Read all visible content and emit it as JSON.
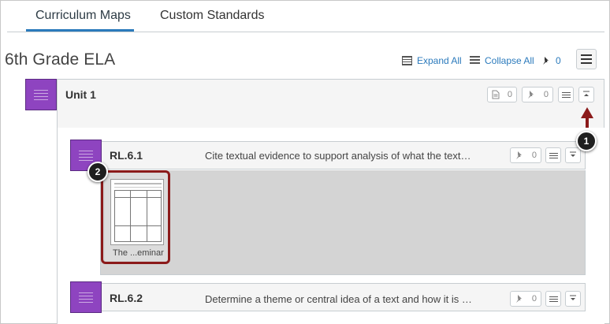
{
  "tabs": [
    {
      "label": "Curriculum Maps",
      "active": true
    },
    {
      "label": "Custom Standards",
      "active": false
    }
  ],
  "header": {
    "title": "6th Grade ELA",
    "expand_all": "Expand All",
    "collapse_all": "Collapse All",
    "pin_count": "0"
  },
  "unit": {
    "title": "Unit 1",
    "doc_count": "0",
    "pin_count": "0"
  },
  "standards": [
    {
      "code": "RL.6.1",
      "description": "Cite textual evidence to support analysis of what the text…",
      "pin_count": "0",
      "documents": [
        {
          "title": "The ...eminar"
        }
      ]
    },
    {
      "code": "RL.6.2",
      "description": "Determine a theme or central idea of a text and how it is …",
      "pin_count": "0"
    }
  ],
  "callouts": [
    "1",
    "2"
  ],
  "colors": {
    "accent": "#2b7abc",
    "unit_swatch": "#8e44c0",
    "callout_highlight": "#8b1a1a"
  },
  "icons": {
    "expand": "expand-all-icon",
    "collapse": "collapse-all-icon",
    "pin": "pin-icon",
    "menu": "hamburger-icon",
    "document": "document-icon",
    "collapse_toggle": "collapse-toggle-icon",
    "expand_toggle": "expand-toggle-icon"
  }
}
